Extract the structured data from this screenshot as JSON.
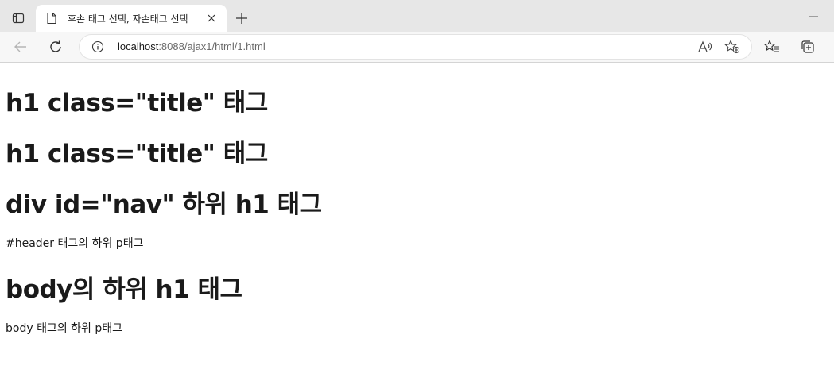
{
  "browser": {
    "tab": {
      "title": "후손 태그 선택, 자손태그 선택"
    },
    "address": {
      "host": "localhost",
      "path": ":8088/ajax1/html/1.html"
    },
    "icons": {
      "tab_actions": "tab-actions-icon",
      "favicon": "page-icon",
      "close": "close-icon",
      "new_tab": "plus-icon",
      "minimize": "minimize-icon",
      "back": "back-arrow-icon",
      "refresh": "refresh-icon",
      "site_info": "info-icon",
      "read_aloud": "read-aloud-icon",
      "add_favorite": "star-plus-icon",
      "favorites": "favorites-icon",
      "collections": "collections-icon"
    }
  },
  "page": {
    "heading_1": "h1 class=\"title\" 태그",
    "heading_2": "h1 class=\"title\" 태그",
    "heading_3": "div id=\"nav\" 하위 h1 태그",
    "paragraph_1": "#header 태그의 하위 p태그",
    "heading_4": "body의 하위 h1 태그",
    "paragraph_2": "body 태그의 하위 p태그"
  }
}
